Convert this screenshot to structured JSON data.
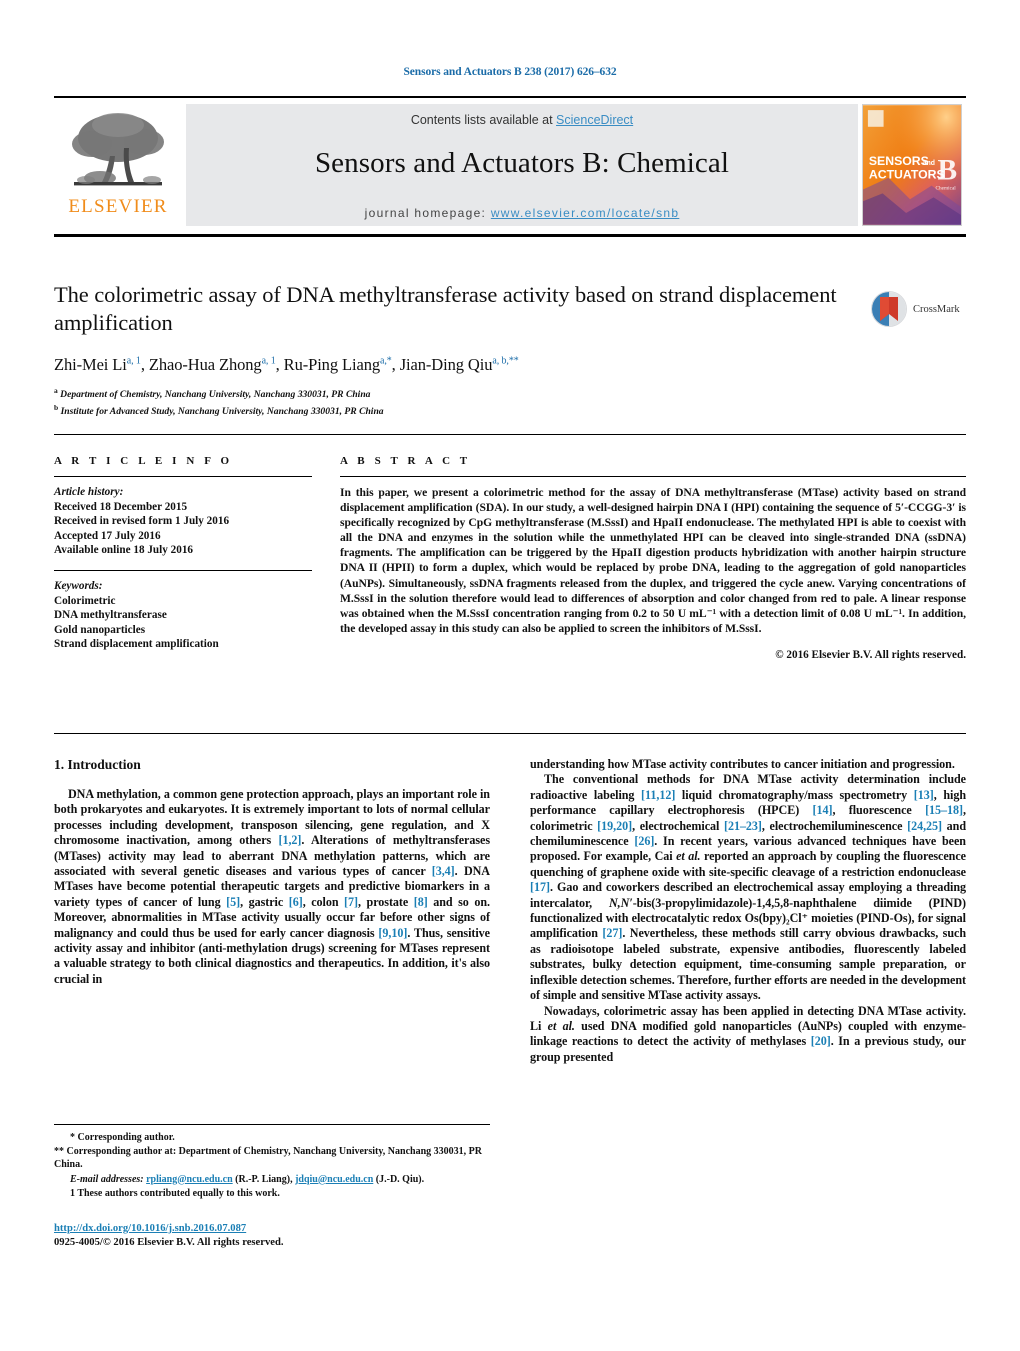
{
  "running_head": "Sensors and Actuators B 238 (2017) 626–632",
  "masthead": {
    "publisher": "ELSEVIER",
    "contents_prefix": "Contents lists available at ",
    "contents_link": "ScienceDirect",
    "journal_title": "Sensors and Actuators B: Chemical",
    "homepage_prefix": "journal homepage: ",
    "homepage_url": "www.elsevier.com/locate/snb",
    "cover_title_1": "SENSORS",
    "cover_title_and": "and",
    "cover_title_2": "ACTUATORS",
    "cover_letter": "B",
    "cover_sub": "Chemical"
  },
  "article": {
    "title": "The colorimetric assay of DNA methyltransferase activity based on strand displacement amplification",
    "authors_html": "Zhi-Mei Li<sup>a, 1</sup>, Zhao-Hua Zhong<sup>a, 1</sup>, Ru-Ping Liang<sup>a,</sup><sup>*</sup>, Jian-Ding Qiu<sup>a, b,</sup><sup>**</sup>",
    "affiliation_a": "Department of Chemistry, Nanchang University, Nanchang 330031, PR China",
    "affiliation_b": "Institute for Advanced Study, Nanchang University, Nanchang 330031, PR China",
    "crossmark_label": "CrossMark"
  },
  "article_info": {
    "heading": "A R T I C L E  I N F O",
    "history_label": "Article history:",
    "history": [
      "Received 18 December 2015",
      "Received in revised form 1 July 2016",
      "Accepted 17 July 2016",
      "Available online 18 July 2016"
    ],
    "keywords_label": "Keywords:",
    "keywords": [
      "Colorimetric",
      "DNA methyltransferase",
      "Gold nanoparticles",
      "Strand displacement amplification"
    ]
  },
  "abstract": {
    "heading": "A B S T R A C T",
    "text": "In this paper, we present a colorimetric method for the assay of DNA methyltransferase (MTase) activity based on strand displacement amplification (SDA). In our study, a well-designed hairpin DNA I (HPI) containing the sequence of 5′-CCGG-3′ is specifically recognized by CpG methyltransferase (M.SssI) and HpaII endonuclease. The methylated HPI is able to coexist with all the DNA and enzymes in the solution while the unmethylated HPI can be cleaved into single-stranded DNA (ssDNA) fragments. The amplification can be triggered by the HpaII digestion products hybridization with another hairpin structure DNA II (HPII) to form a duplex, which would be replaced by probe DNA, leading to the aggregation of gold nanoparticles (AuNPs). Simultaneously, ssDNA fragments released from the duplex, and triggered the cycle anew. Varying concentrations of M.SssI in the solution therefore would lead to differences of absorption and color changed from red to pale. A linear response was obtained when the M.SssI concentration ranging from 0.2 to 50 U mL⁻¹ with a detection limit of 0.08 U mL⁻¹. In addition, the developed assay in this study can also be applied to screen the inhibitors of M.SssI.",
    "copyright": "© 2016 Elsevier B.V. All rights reserved."
  },
  "body": {
    "section_heading": "1. Introduction",
    "left_paragraphs": [
      "DNA methylation, a common gene protection approach, plays an important role in both prokaryotes and eukaryotes. It is extremely important to lots of normal cellular processes including development, transposon silencing, gene regulation, and X chromosome inactivation, among others [1,2]. Alterations of methyltransferases (MTases) activity may lead to aberrant DNA methylation patterns, which are associated with several genetic diseases and various types of cancer [3,4]. DNA MTases have become potential therapeutic targets and predictive biomarkers in a variety types of cancer of lung [5], gastric [6], colon [7], prostate [8] and so on. Moreover, abnormalities in MTase activity usually occur far before other signs of malignancy and could thus be used for early cancer diagnosis [9,10]. Thus, sensitive activity assay and inhibitor (anti-methylation drugs) screening for MTases represent a valuable strategy to both clinical diagnostics and therapeutics. In addition, it's also crucial in"
    ],
    "right_paragraphs": [
      "understanding how MTase activity contributes to cancer initiation and progression.",
      "The conventional methods for DNA MTase activity determination include radioactive labeling [11,12] liquid chromatography/mass spectrometry [13], high performance capillary electrophoresis (HPCE) [14], fluorescence [15–18], colorimetric [19,20], electrochemical [21–23], electrochemiluminescence [24,25] and chemiluminescence [26]. In recent years, various advanced techniques have been proposed. For example, Cai et al. reported an approach by coupling the fluorescence quenching of graphene oxide with site-specific cleavage of a restriction endonuclease [17]. Gao and coworkers described an electrochemical assay employing a threading intercalator, N,N′-bis(3-propylimidazole)-1,4,5,8-naphthalene diimide (PIND) functionalized with electrocatalytic redox Os(bpy)₂Cl⁺ moieties (PIND-Os), for signal amplification [27]. Nevertheless, these methods still carry obvious drawbacks, such as radioisotope labeled substrate, expensive antibodies, fluorescently labeled substrates, bulky detection equipment, time-consuming sample preparation, or inflexible detection schemes. Therefore, further efforts are needed in the development of simple and sensitive MTase activity assays.",
      "Nowadays, colorimetric assay has been applied in detecting DNA MTase activity. Li et al. used DNA modified gold nanoparticles (AuNPs) coupled with enzyme-linkage reactions to detect the activity of methylases [20]. In a previous study, our group presented"
    ]
  },
  "footnotes": {
    "corresponding_1": "* Corresponding author.",
    "corresponding_2": "** Corresponding author at: Department of Chemistry, Nanchang University, Nanchang 330031, PR China.",
    "email_label": "E-mail addresses:",
    "email_1": "rpliang@ncu.edu.cn",
    "email_1_name": "(R.-P. Liang),",
    "email_2": "jdqiu@ncu.edu.cn",
    "email_2_name": "(J.-D. Qiu).",
    "equal_contrib": "1 These authors contributed equally to this work.",
    "doi": "http://dx.doi.org/10.1016/j.snb.2016.07.087",
    "issn": "0925-4005/© 2016 Elsevier B.V. All rights reserved."
  },
  "colors": {
    "link_blue": "#1b7fb5",
    "elsevier_orange": "#f08c1b",
    "band_grey": "#e7e8ea"
  }
}
